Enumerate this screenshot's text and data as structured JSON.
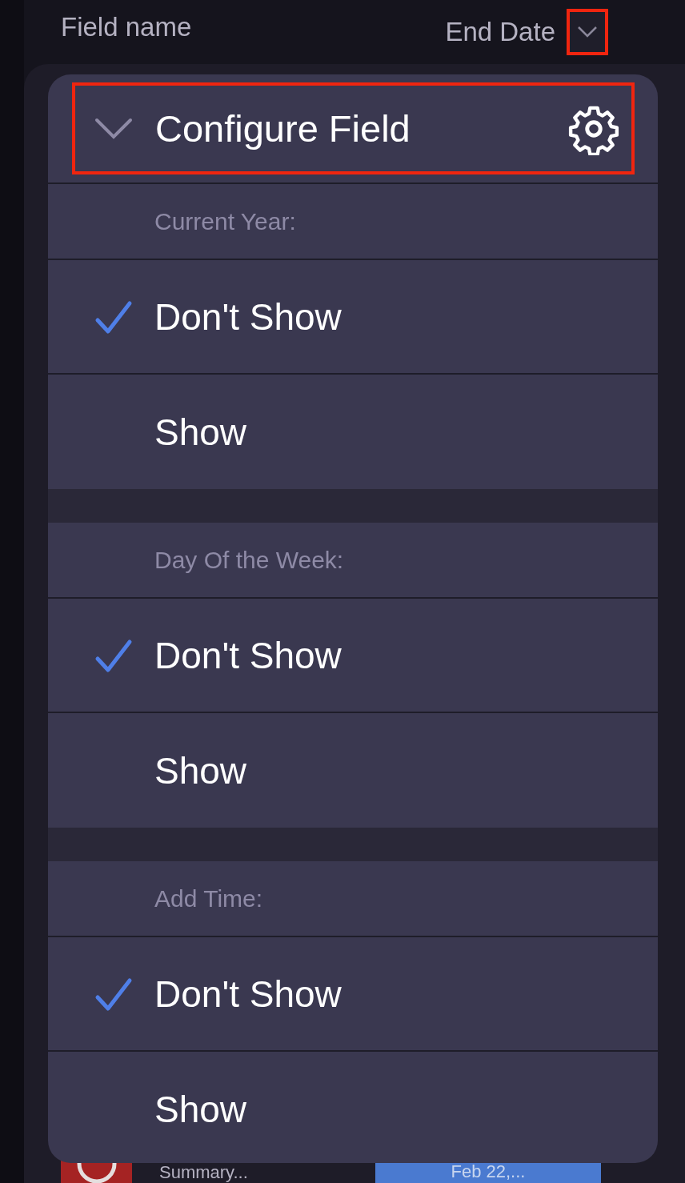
{
  "header": {
    "field_label": "Field name",
    "value": "End Date",
    "dropdown": {
      "highlighted": true
    }
  },
  "menu": {
    "title": "Configure Field",
    "highlighted": true,
    "expanded": true,
    "sections": [
      {
        "label": "Current Year:",
        "options": [
          {
            "label": "Don't Show",
            "selected": true
          },
          {
            "label": "Show",
            "selected": false
          }
        ]
      },
      {
        "label": "Day Of the Week:",
        "options": [
          {
            "label": "Don't Show",
            "selected": true
          },
          {
            "label": "Show",
            "selected": false
          }
        ]
      },
      {
        "label": "Add Time:",
        "options": [
          {
            "label": "Don't Show",
            "selected": true
          },
          {
            "label": "Show",
            "selected": false
          }
        ]
      }
    ]
  },
  "background_row": {
    "title": "Summary...",
    "date": "Feb 22,..."
  }
}
